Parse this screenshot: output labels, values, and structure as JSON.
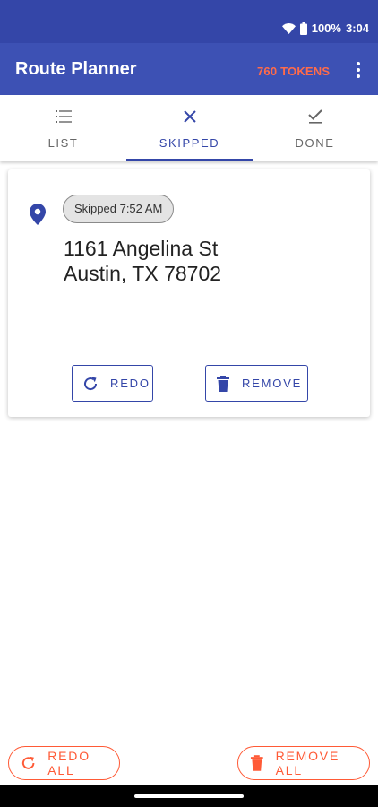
{
  "status_bar": {
    "battery": "100%",
    "time": "3:04",
    "icons": [
      "wifi-icon",
      "battery-icon"
    ]
  },
  "app_bar": {
    "title": "Route Planner",
    "tokens": "760 TOKENS",
    "menu_icon": "more-vert-icon"
  },
  "tabs": [
    {
      "label": "LIST",
      "icon": "list-icon",
      "active": false
    },
    {
      "label": "SKIPPED",
      "icon": "close-icon",
      "active": true
    },
    {
      "label": "DONE",
      "icon": "check-icon",
      "active": false
    }
  ],
  "stop_card": {
    "icon": "location-pin-icon",
    "badge": "Skipped 7:52 AM",
    "address_line1": "1161 Angelina St",
    "address_line2": "Austin, TX 78702",
    "redo_label": "REDO",
    "remove_label": "REMOVE"
  },
  "bottom_actions": {
    "redo_all_label": "REDO ALL",
    "remove_all_label": "REMOVE ALL"
  },
  "colors": {
    "primary": "#3d51b4",
    "status_bar": "#3446a8",
    "accent": "#ff5a36",
    "tokens": "#ff6b4a"
  }
}
